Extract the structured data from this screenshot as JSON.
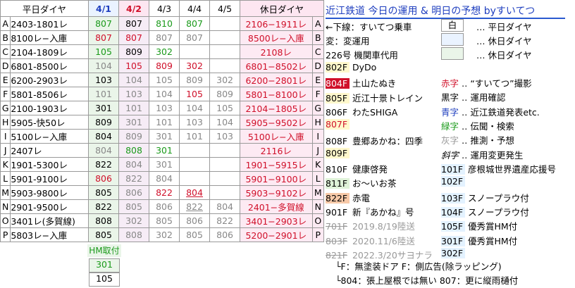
{
  "header": {
    "c0": "平日ダイヤ",
    "d1": "4/1",
    "d2": "4/2",
    "d3": "4/3",
    "d4": "4/4",
    "d5": "4/5",
    "hol": "休日ダイヤ"
  },
  "rows": [
    {
      "k": "A",
      "w": "2403-1801レ",
      "v": [
        "807",
        "807",
        "810",
        "807",
        ""
      ],
      "h": "2106−1911レ"
    },
    {
      "k": "B",
      "w": "8100レ−入庫",
      "v": [
        "807",
        "807",
        "807",
        "807",
        ""
      ],
      "h": "8500レ−入庫"
    },
    {
      "k": "C",
      "w": "2104-1809レ",
      "v": [
        "105",
        "809",
        "302",
        "",
        ""
      ],
      "h": "2108レ"
    },
    {
      "k": "D",
      "w": "6801-8500レ",
      "v": [
        "104",
        "105",
        "809",
        "302",
        ""
      ],
      "h": "6801−8502レ"
    },
    {
      "k": "E",
      "w": "6200-2903レ",
      "v": [
        "103",
        "104",
        "105",
        "809",
        "302"
      ],
      "h": "6200−2801レ"
    },
    {
      "k": "F",
      "w": "5801-8506レ",
      "v": [
        "101",
        "103",
        "104",
        "105",
        "809"
      ],
      "h": "5801−8100レ"
    },
    {
      "k": "G",
      "w": "2100-1903レ",
      "v": [
        "301",
        "101",
        "103",
        "104",
        "105"
      ],
      "h": "2104−1805レ"
    },
    {
      "k": "H",
      "w": "5905-快50レ",
      "v": [
        "809",
        "301",
        "101",
        "103",
        "104"
      ],
      "h": "5905−9502レ"
    },
    {
      "k": "I",
      "w": "5100レ−入庫",
      "v": [
        "804",
        "809",
        "301",
        "101",
        "103"
      ],
      "h": "5100レ−入庫"
    },
    {
      "k": "J",
      "w": "2407レ",
      "v": [
        "804",
        "808",
        "301",
        "",
        ""
      ],
      "h": "2116レ"
    },
    {
      "k": "K",
      "w": "1901-5300レ",
      "v": [
        "822",
        "804",
        "301",
        "",
        ""
      ],
      "h": "1901−5915レ"
    },
    {
      "k": "L",
      "w": "5901-9100レ",
      "v": [
        "806",
        "822",
        "804",
        "",
        ""
      ],
      "h": "5901−9100レ"
    },
    {
      "k": "M",
      "w": "5903-9800レ",
      "v": [
        "805",
        "806",
        "822",
        "804",
        ""
      ],
      "h": "5903−9102レ"
    },
    {
      "k": "N",
      "w": "2901-9500レ",
      "v": [
        "822",
        "805",
        "806",
        "822",
        "804"
      ],
      "h": "2401−多賀線"
    },
    {
      "k": "O",
      "w": "3401レ(多賀線)",
      "v": [
        "808",
        "302",
        "805",
        "806",
        "822"
      ],
      "h": "3401−2903レ"
    },
    {
      "k": "P",
      "w": "5803レ−入庫",
      "v": [
        "805",
        "808",
        "302",
        "805",
        "806"
      ],
      "h": "5200−2901レ"
    }
  ],
  "extra": {
    "hm": "HM取付",
    "v1": "301",
    "v2": "105"
  },
  "title": "近江鉄道 今日の運用 & 明日の予想 byすいてつ",
  "right": {
    "l1": "←下線：すいてつ乗車",
    "l2": "変：変運用",
    "l3": "226号 機関車代用",
    "leg1": "白",
    "leg1t": "… 平日ダイヤ",
    "leg2t": "… 休日ダイヤ",
    "leg3t": "… 休日ダイヤ",
    "trains": [
      {
        "n": "802F",
        "t": "DyDo"
      },
      {
        "n": "804F",
        "t": "土山たぬき"
      },
      {
        "n": "805F",
        "t": "近江十景トレイン"
      },
      {
        "n": "806F",
        "t": "わたSHIGA"
      },
      {
        "n": "807F",
        "t": ""
      },
      {
        "n": "808F",
        "t": "豊郷あかね：四季"
      },
      {
        "n": "809F",
        "t": ""
      },
      {
        "n": "810F",
        "t": "健康啓発"
      },
      {
        "n": "811F",
        "t": "お〜いお茶"
      },
      {
        "n": "822F",
        "t": "赤電"
      },
      {
        "n": "901F",
        "t": "新『あかね』号"
      },
      {
        "n": "701F",
        "t": "2019.8/19陸送"
      },
      {
        "n": "803F",
        "t": "2020.11/6陸送"
      },
      {
        "n": "821F",
        "t": "2022.3/20サヨナラ"
      }
    ],
    "colors": [
      {
        "k": "赤字",
        "t": "‥ “すいてつ”撮影"
      },
      {
        "k": "黒字",
        "t": "‥ 運用確認"
      },
      {
        "k": "青字",
        "t": "‥ 近江鉄道発表etc."
      },
      {
        "k": "緑字",
        "t": "‥ 伝聞・検索"
      },
      {
        "k": "灰字",
        "t": "‥ 推測・予想"
      },
      {
        "k": "斜字",
        "t": "‥ 運用変更発生"
      }
    ],
    "hm": [
      {
        "n": "101F",
        "t": "彦根城世界遺産応援号"
      },
      {
        "n": "102F",
        "t": ""
      },
      {
        "n": "103F",
        "t": "スノープラウ付"
      },
      {
        "n": "104F",
        "t": "スノープラウ付"
      },
      {
        "n": "105F",
        "t": "優秀賞HM付"
      },
      {
        "n": "301F",
        "t": "優秀賞HM付"
      },
      {
        "n": "302F",
        "t": ""
      }
    ],
    "foot1": "└F：無塗装ドア  F：側広告(除ラッピング)",
    "foot2": "└804：張上屋根では無い  807：更に縦雨樋付"
  },
  "colors": {
    "today": "#eaf5e9",
    "tomorrow": "#f6ecf6",
    "holiday": "#fdeaf3",
    "accent": "#1f3fbf",
    "red": "#d0102a"
  }
}
